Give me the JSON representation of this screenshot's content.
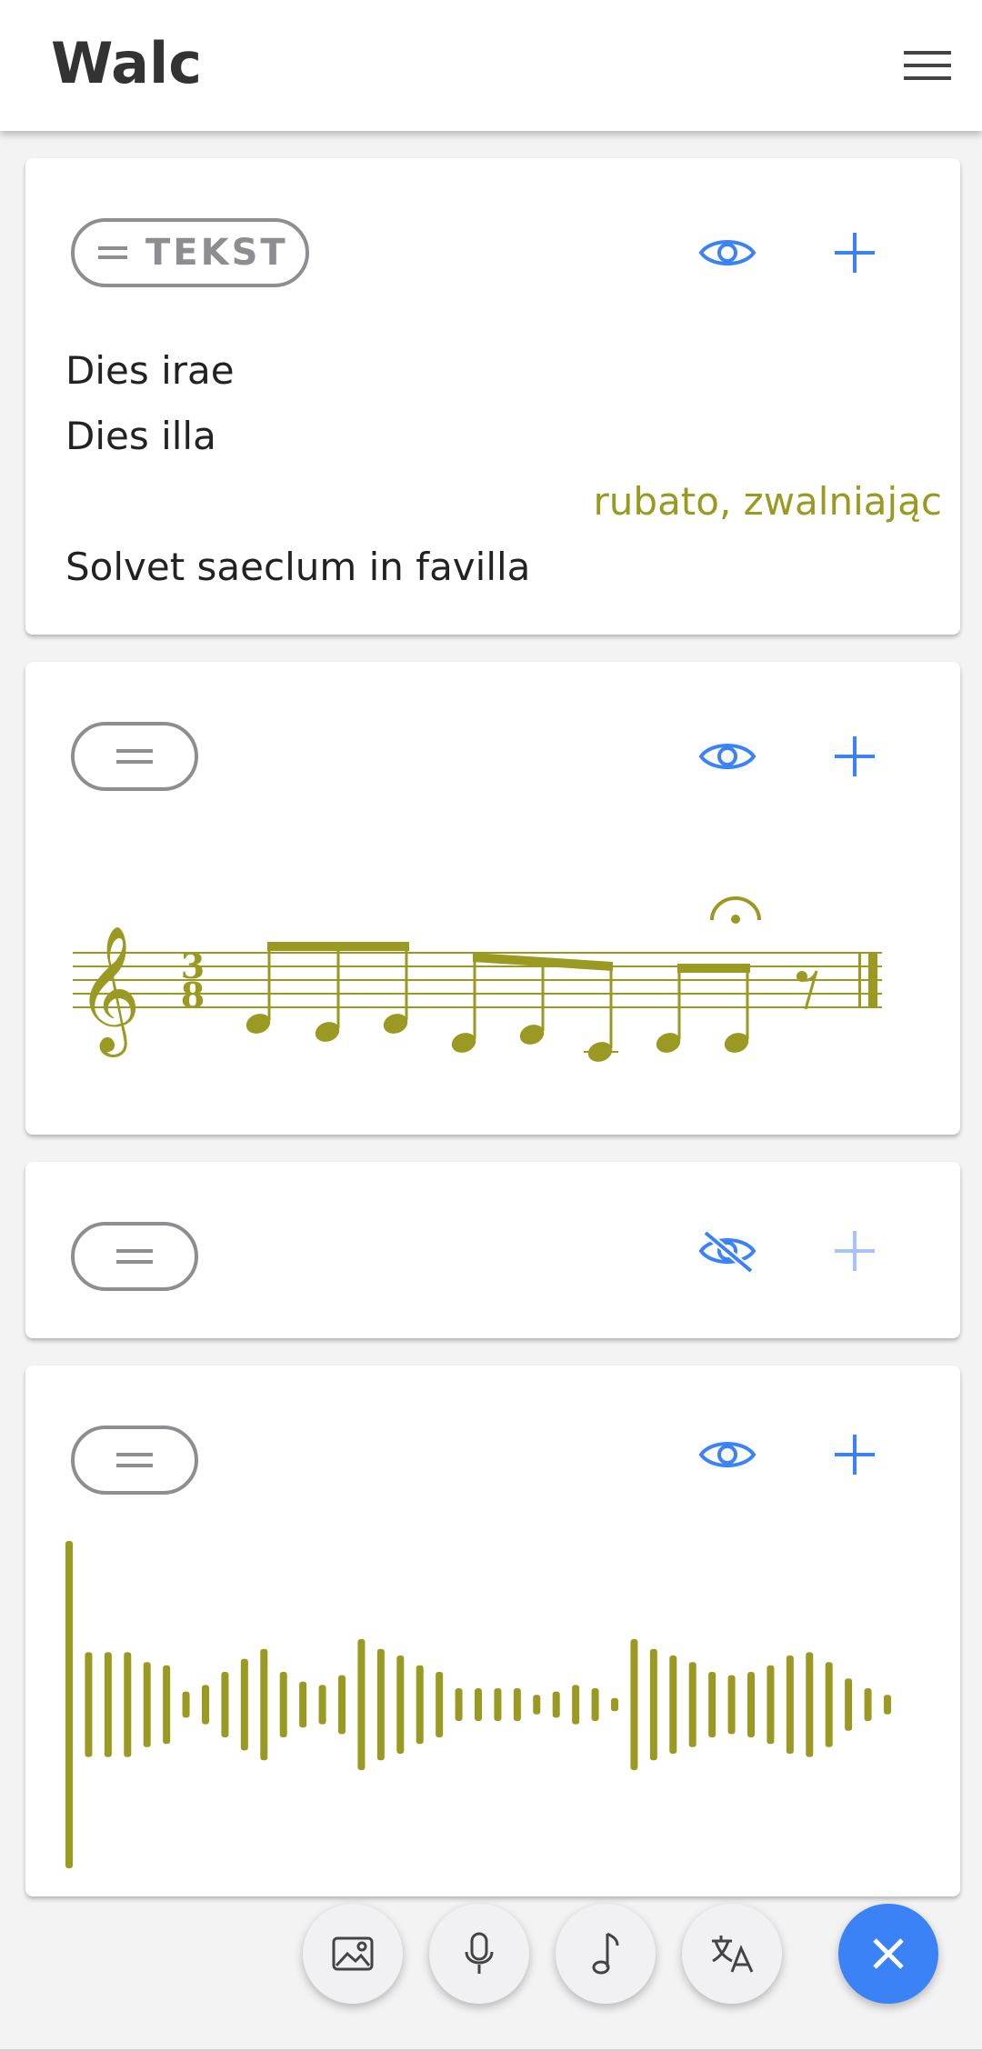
{
  "header": {
    "title": "Walc",
    "menu_icon": "menu-icon"
  },
  "colors": {
    "accent": "#3b82f6",
    "music": "#9a9a22",
    "handle": "#8e8e92"
  },
  "cards": [
    {
      "type": "text",
      "handle_label": "TEKST",
      "visible": true,
      "lines": [
        {
          "text": "Dies irae",
          "style": "lyric"
        },
        {
          "text": "Dies illa",
          "style": "lyric"
        },
        {
          "text": "rubato, zwalniając",
          "style": "direction"
        },
        {
          "text": "Solvet saeclum in favilla",
          "style": "lyric"
        }
      ]
    },
    {
      "type": "score",
      "visible": true,
      "time_signature": {
        "top": "3",
        "bottom": "8"
      },
      "clef": "treble-clef"
    },
    {
      "type": "empty",
      "visible": false
    },
    {
      "type": "audio",
      "visible": true,
      "waveform_levels": [
        1,
        0.32,
        0.32,
        0.32,
        0.26,
        0.24,
        0.08,
        0.12,
        0.2,
        0.28,
        0.34,
        0.2,
        0.14,
        0.12,
        0.18,
        0.4,
        0.34,
        0.3,
        0.24,
        0.2,
        0.1,
        0.1,
        0.1,
        0.1,
        0.06,
        0.08,
        0.12,
        0.1,
        0.04,
        0.4,
        0.34,
        0.3,
        0.26,
        0.2,
        0.18,
        0.2,
        0.24,
        0.3,
        0.32,
        0.26,
        0.16,
        0.1,
        0.06
      ]
    }
  ],
  "toolbar": {
    "buttons": [
      {
        "name": "add-image-button",
        "icon": "image-icon"
      },
      {
        "name": "add-audio-button",
        "icon": "microphone-icon"
      },
      {
        "name": "add-score-button",
        "icon": "music-note-icon"
      },
      {
        "name": "add-text-button",
        "icon": "translate-icon"
      }
    ],
    "close_icon": "close-icon"
  }
}
